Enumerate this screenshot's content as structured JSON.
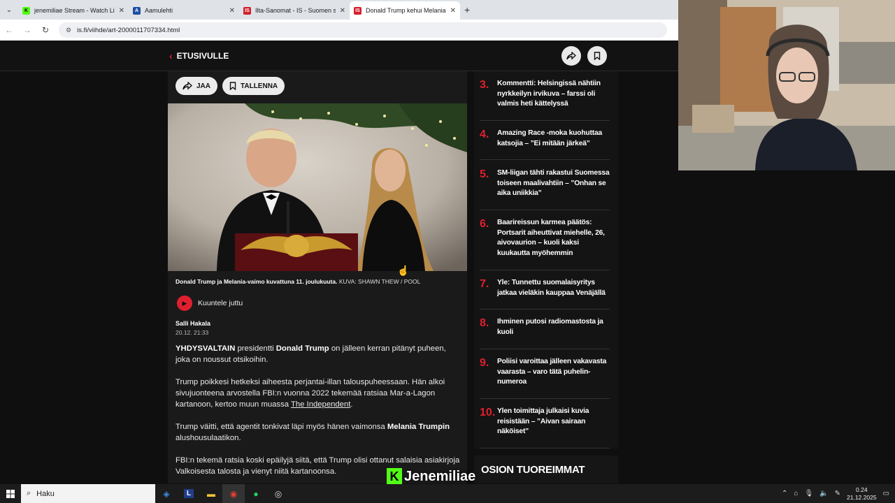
{
  "browser": {
    "tabs": [
      {
        "title": "jenemiliae Stream - Watch Live",
        "icon": "kick-icon",
        "color": "#53fc18",
        "letter": "K",
        "active": false
      },
      {
        "title": "Aamulehti",
        "icon": "aamulehti-icon",
        "color": "#1f4fa3",
        "letter": "A",
        "active": false
      },
      {
        "title": "Ilta-Sanomat - IS - Suomen suu",
        "icon": "is-icon",
        "color": "#d4202c",
        "letter": "IS",
        "active": false
      },
      {
        "title": "Donald Trump kehui Melanian",
        "icon": "is-icon",
        "color": "#d4202c",
        "letter": "IS",
        "active": true
      }
    ],
    "url": "is.fi/viihde/art-2000011707334.html"
  },
  "header": {
    "back_label": "ETUSIVULLE"
  },
  "article": {
    "share_label": "JAA",
    "save_label": "TALLENNA",
    "caption_bold": "Donald Trump ja Melania-vaimo kuvattuna 11. joulukuuta.",
    "caption_credit": "KUVA: SHAWN THEW / POOL",
    "listen_label": "Kuuntele juttu",
    "author": "Salli Hakala",
    "date": "20.12. 21:33",
    "p1_bold1": "YHDYSVALTAIN",
    "p1_text1": " presidentti ",
    "p1_bold2": "Donald Trump",
    "p1_text2": " on jälleen kerran pitänyt puheen, joka on noussut otsikoihin.",
    "p2_text1": "Trump poikkesi hetkeksi aiheesta perjantai-illan talouspuheessaan. Hän alkoi sivujuonteena arvostella FBI:n vuonna 2022 tekemää ratsiaa Mar-a-Lagon kartanoon, kertoo muun muassa ",
    "p2_link": "The Independent",
    "p2_text2": ".",
    "p3_text1": "Trump väitti, että agentit tonkivat läpi myös hänen vaimonsa ",
    "p3_bold": "Melania Trumpin",
    "p3_text2": " alushousulaatikon.",
    "p4_text": "FBI:n tekemä ratsia koski epäilyjä siitä, että Trump olisi ottanut salaisia asiakirjoja Valkoisesta talosta ja vienyt niitä kartanoonsa."
  },
  "sidebar": {
    "items": [
      {
        "num": "3.",
        "title": "Kommentti: Helsingissä nähtiin nyrkkeilyn irvikuva – farssi oli valmis heti kättelyssä"
      },
      {
        "num": "4.",
        "title": "Amazing Race -moka kuohuttaa katsojia – ”Ei mitään järkeä”"
      },
      {
        "num": "5.",
        "title": "SM-liigan tähti rakastui Suomessa toiseen maalivahtiin – ”Onhan se aika uniikkia”"
      },
      {
        "num": "6.",
        "title": "Baarireissun karmea päätös: Portsarit aiheuttivat miehelle, 26, aivovaurion – kuoli kaksi kuukautta myöhemmin"
      },
      {
        "num": "7.",
        "title": "Yle: Tunnettu suomalaisyritys jatkaa vieläkin kauppaa Venäjällä"
      },
      {
        "num": "8.",
        "title": "Ihminen putosi radiomastosta ja kuoli"
      },
      {
        "num": "9.",
        "title": "Poliisi varoittaa jälleen vakavasta vaarasta – varo tätä puhelin-numeroa"
      },
      {
        "num": "10.",
        "title": "Ylen toimittaja julkaisi kuvia reisistään – ”Aivan sairaan näköiset”"
      }
    ],
    "section_title": "OSION TUOREIMMAT"
  },
  "overlay": {
    "name": "Jenemiliae"
  },
  "taskbar": {
    "search_placeholder": "Haku",
    "time": "0.24",
    "date": "21.12.2025"
  },
  "colors": {
    "accent": "#e0202e",
    "kick": "#53fc18"
  }
}
